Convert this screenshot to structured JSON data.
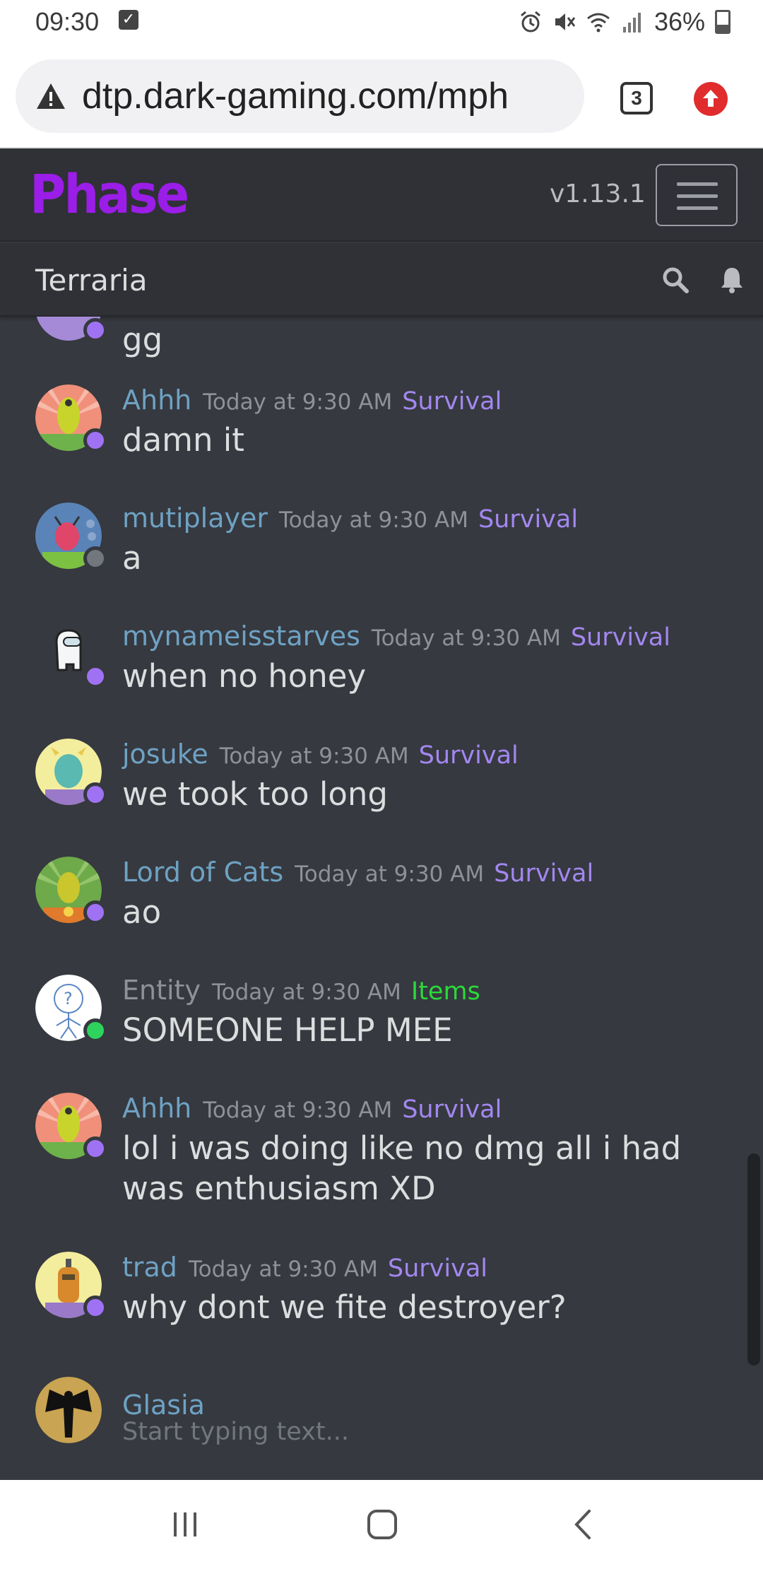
{
  "statusbar": {
    "time": "09:30",
    "battery": "36%",
    "icons": [
      "check-icon",
      "alarm-icon",
      "mute-icon",
      "wifi-icon",
      "signal-icon",
      "battery-icon"
    ]
  },
  "browser": {
    "url": "dtp.dark-gaming.com/mph",
    "tab_count": "3"
  },
  "app": {
    "logo": "Phase",
    "version": "v1.13.1",
    "channel": "Terraria"
  },
  "colors": {
    "background": "#36393f",
    "header": "#2f3136",
    "logo": "#9b1de8",
    "username": "#6ea2c4",
    "server_survival": "#a387f0",
    "server_items": "#2bd93a",
    "status_idle": "#9f72f4",
    "status_online": "#2dd35d",
    "status_offline": "#72767d"
  },
  "messages": [
    {
      "text": "gg"
    },
    {
      "user": "Ahhh",
      "time": "Today at 9:30 AM",
      "server": "Survival",
      "text": "damn it",
      "status": "idle"
    },
    {
      "user": "mutiplayer",
      "time": "Today at 9:30 AM",
      "server": "Survival",
      "text": "a",
      "status": "offline"
    },
    {
      "user": "mynameisstarves",
      "time": "Today at 9:30 AM",
      "server": "Survival",
      "text": "when no honey",
      "status": "idle"
    },
    {
      "user": "josuke",
      "time": "Today at 9:30 AM",
      "server": "Survival",
      "text": "we took too long",
      "status": "idle"
    },
    {
      "user": "Lord of Cats",
      "time": "Today at 9:30 AM",
      "server": "Survival",
      "text": "ao",
      "status": "idle"
    },
    {
      "user": "Entity",
      "time": "Today at 9:30 AM",
      "server": "Items",
      "text": "SOMEONE HELP MEE",
      "status": "online"
    },
    {
      "user": "Ahhh",
      "time": "Today at 9:30 AM",
      "server": "Survival",
      "text": "lol i was doing like no dmg all i had was enthusiasm XD",
      "status": "idle"
    },
    {
      "user": "trad",
      "time": "Today at 9:30 AM",
      "server": "Survival",
      "text": "why dont we fite destroyer?",
      "status": "idle"
    }
  ],
  "composer": {
    "user": "Glasia",
    "placeholder": "Start typing text..."
  }
}
